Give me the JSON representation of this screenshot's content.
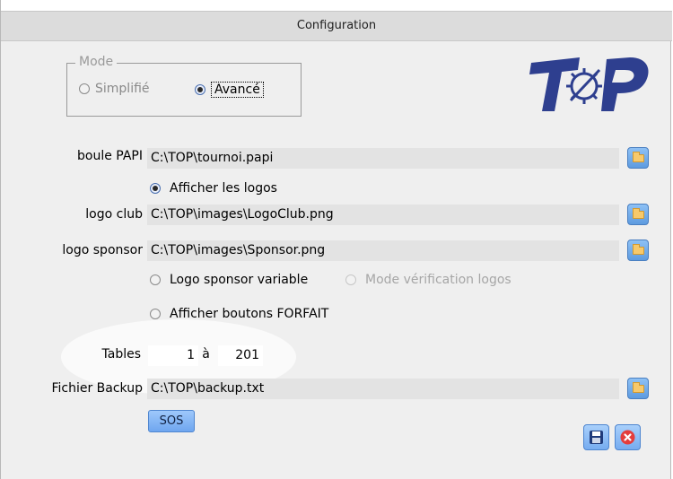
{
  "window": {
    "title": "Configuration"
  },
  "logo": {
    "text": "TOP"
  },
  "mode": {
    "legend": "Mode",
    "options": [
      {
        "label": "Simplifié",
        "selected": false
      },
      {
        "label": "Avancé",
        "selected": true
      }
    ]
  },
  "rows": {
    "boule_papi": {
      "label": "boule PAPI",
      "value": "C:\\TOP\\tournoi.papi"
    },
    "afficher_logos": {
      "label": "Afficher les logos",
      "checked": true
    },
    "logo_club": {
      "label": "logo club",
      "value": "C:\\TOP\\images\\LogoClub.png"
    },
    "logo_sponsor": {
      "label": "logo sponsor",
      "value": "C:\\TOP\\images\\Sponsor.png"
    },
    "logo_sponsor_variable": {
      "label": "Logo sponsor variable",
      "checked": false
    },
    "mode_verification": {
      "label": "Mode vérification logos",
      "checked": false,
      "enabled": false
    },
    "afficher_forfait": {
      "label": "Afficher boutons FORFAIT",
      "checked": false
    },
    "tables": {
      "label": "Tables",
      "from": "1",
      "separator": "à",
      "to": "201"
    },
    "fichier_backup": {
      "label": "Fichier Backup",
      "value": "C:\\TOP\\backup.txt"
    }
  },
  "buttons": {
    "sos": "SOS"
  },
  "icons": {
    "folder": "folder-icon",
    "save": "floppy-disk-icon",
    "cancel": "close-circle-icon"
  },
  "colors": {
    "accent": "#6fa6ef",
    "logo": "#2e3f8f",
    "cancel": "#e43d3d"
  }
}
